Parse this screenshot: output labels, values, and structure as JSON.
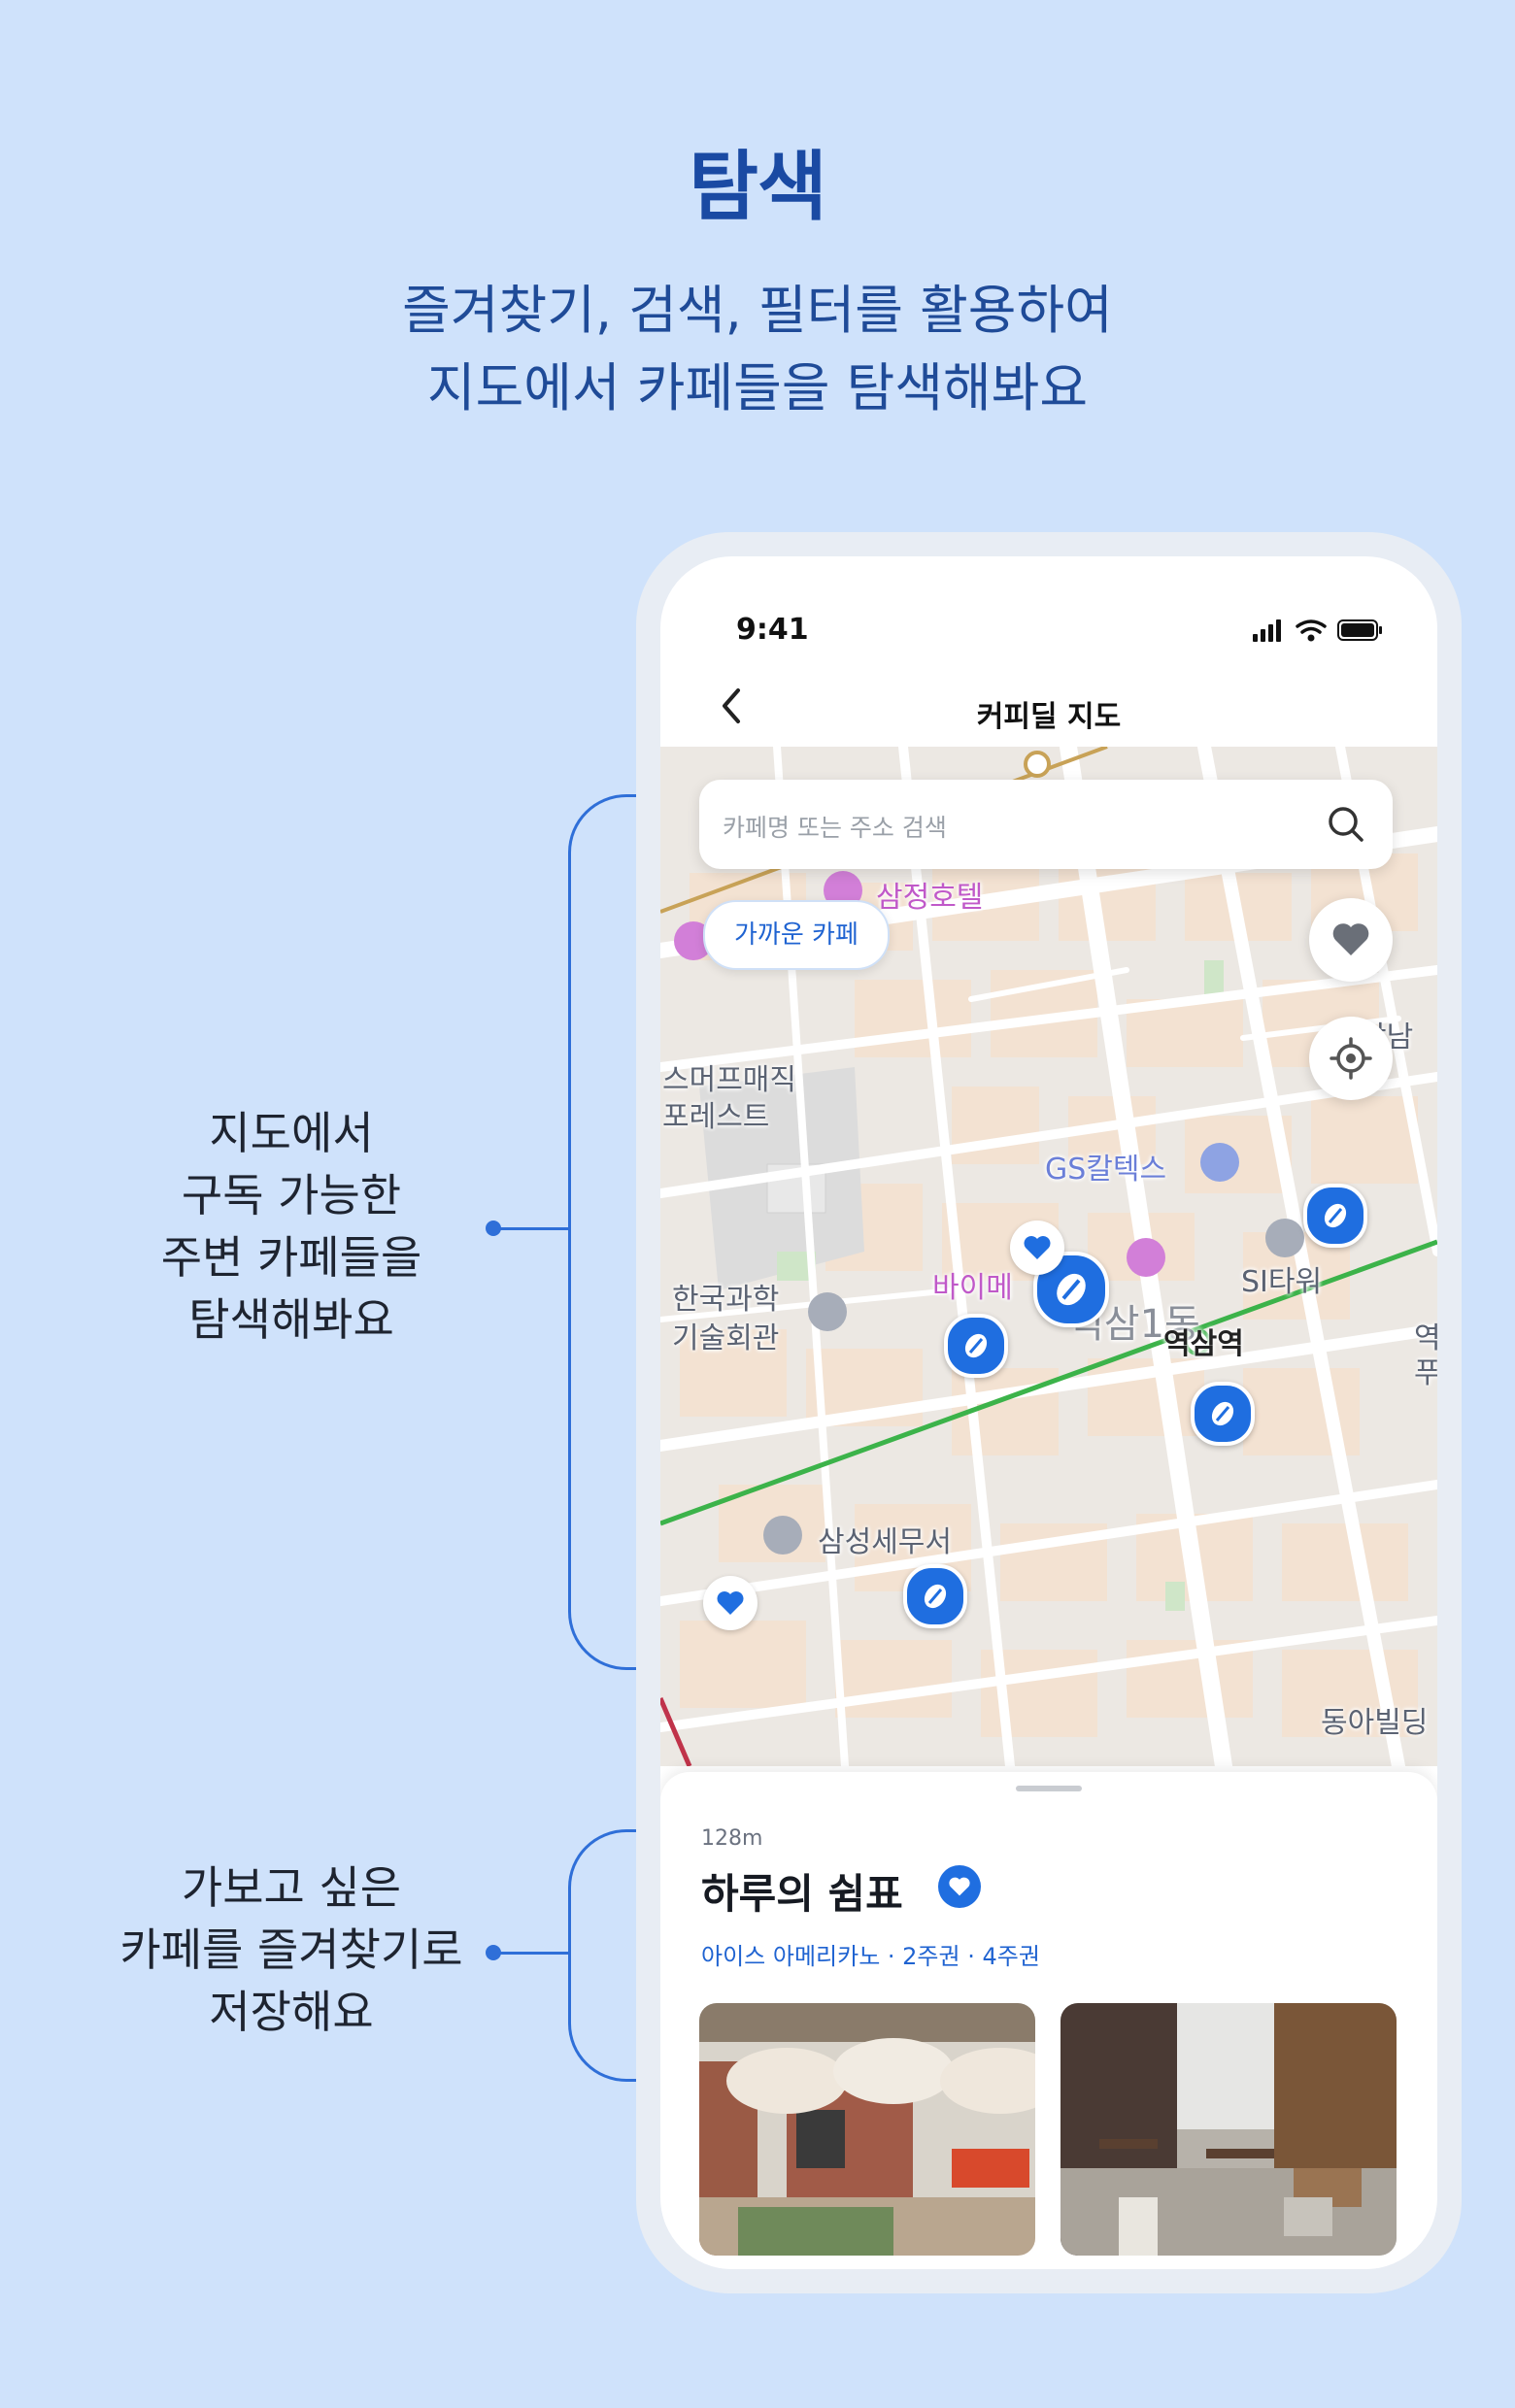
{
  "hero": {
    "title": "탐색",
    "subtitle_lines": [
      "즐겨찾기, 검색, 필터를 활용하여",
      "지도에서 카페들을 탐색해봐요"
    ]
  },
  "annotations": [
    {
      "lines": [
        "지도에서",
        "구독 가능한",
        "주변 카페들을",
        "탐색해봐요"
      ]
    },
    {
      "lines": [
        "가보고 싶은",
        "카페를 즐겨찾기로",
        "저장해요"
      ]
    }
  ],
  "status_bar": {
    "time": "9:41"
  },
  "navbar": {
    "title": "커피딜 지도",
    "back_icon": "chevron-left-icon"
  },
  "search": {
    "placeholder": "카페명 또는 주소 검색",
    "icon": "search-icon"
  },
  "filter_chip": {
    "label": "가까운 카페"
  },
  "map_controls": [
    {
      "icon": "heart-icon"
    },
    {
      "icon": "locate-icon"
    }
  ],
  "map_labels": {
    "hotel": "삼정호텔",
    "smart": "스머프매직",
    "smart2": "포레스트",
    "gs": "GS칼텍스",
    "kangnam": "강남",
    "si": "SI타워",
    "korea1": "한국과학",
    "korea2": "기술회관",
    "buy": "바이메",
    "exit": "역삼1동",
    "station": "역삼역",
    "station_side1": "역",
    "station_side2": "푸",
    "tax": "삼성세무서",
    "dong": "동아빌딩"
  },
  "sheet": {
    "distance": "128m",
    "cafe_name": "하루의 쉼표",
    "menu": "아이스 아메리카노 · 2주권 · 4주권"
  },
  "colors": {
    "accent": "#1f6ee0",
    "background": "#cfe2fb",
    "subway": "#3cb34a"
  }
}
